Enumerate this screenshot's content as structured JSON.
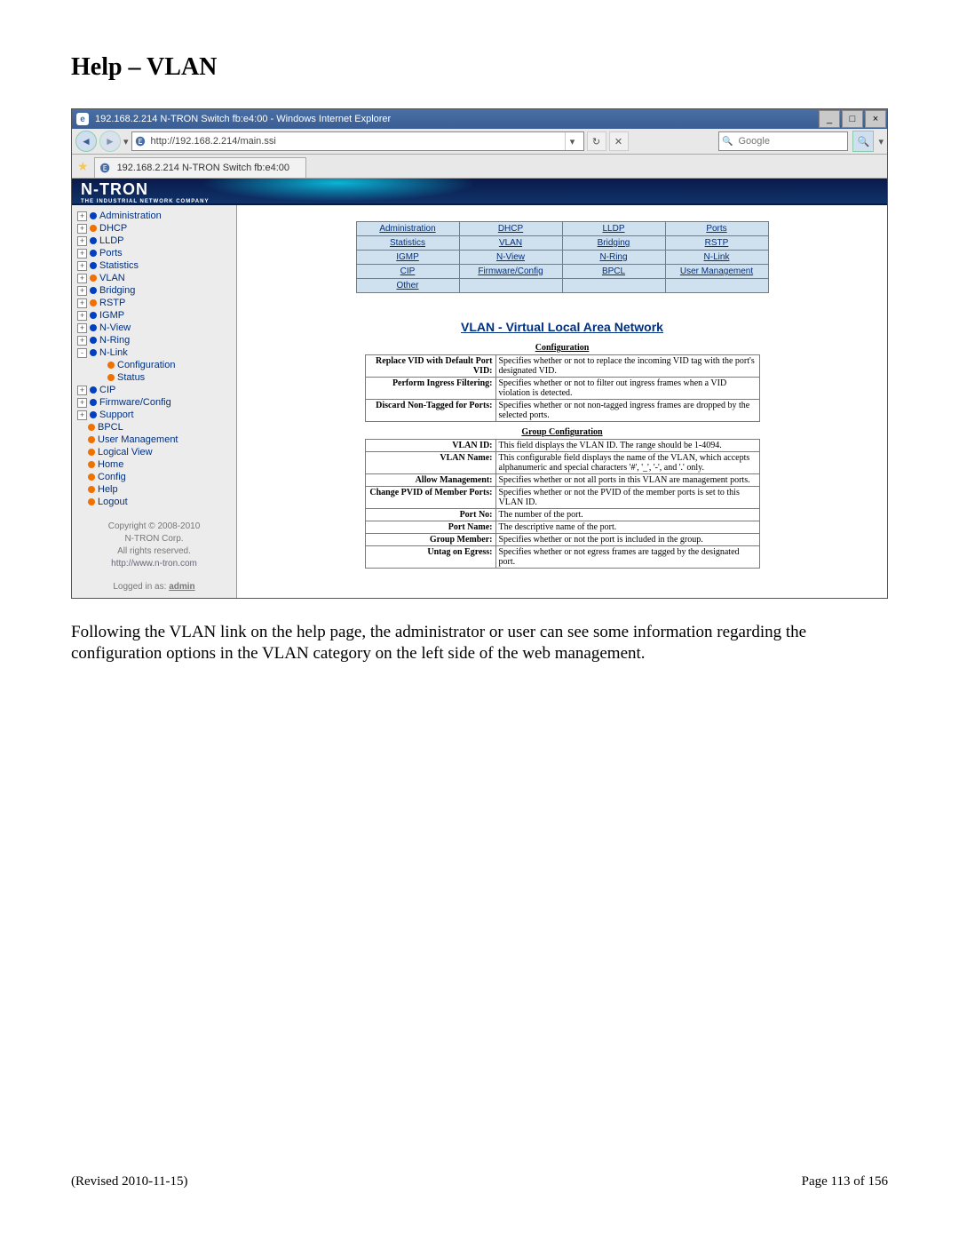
{
  "doc": {
    "heading": "Help – VLAN",
    "description": "Following the VLAN link on the help page, the administrator or user can see some information regarding the configuration options in the VLAN category on the left side of the web management.",
    "revised": "(Revised 2010-11-15)",
    "page": "Page 113 of 156"
  },
  "browser": {
    "title": "192.168.2.214 N-TRON Switch fb:e4:00 - Windows Internet Explorer",
    "url": "http://192.168.2.214/main.ssi",
    "search_placeholder": "Google",
    "tab": "192.168.2.214 N-TRON Switch fb:e4:00"
  },
  "logo": {
    "brand": "N-TRON",
    "tag": "THE INDUSTRIAL NETWORK COMPANY"
  },
  "tree": [
    {
      "exp": "+",
      "dot": "blue",
      "label": "Administration"
    },
    {
      "exp": "+",
      "dot": "orange",
      "label": "DHCP"
    },
    {
      "exp": "+",
      "dot": "blue",
      "label": "LLDP"
    },
    {
      "exp": "+",
      "dot": "blue",
      "label": "Ports"
    },
    {
      "exp": "+",
      "dot": "blue",
      "label": "Statistics"
    },
    {
      "exp": "+",
      "dot": "orange",
      "label": "VLAN"
    },
    {
      "exp": "+",
      "dot": "blue",
      "label": "Bridging"
    },
    {
      "exp": "+",
      "dot": "orange",
      "label": "RSTP"
    },
    {
      "exp": "+",
      "dot": "blue",
      "label": "IGMP"
    },
    {
      "exp": "+",
      "dot": "blue",
      "label": "N-View"
    },
    {
      "exp": "+",
      "dot": "blue",
      "label": "N-Ring"
    },
    {
      "exp": "-",
      "dot": "blue",
      "label": "N-Link"
    },
    {
      "exp": "",
      "dot": "orange",
      "label": "Configuration",
      "child": true
    },
    {
      "exp": "",
      "dot": "orange",
      "label": "Status",
      "child": true
    },
    {
      "exp": "+",
      "dot": "blue",
      "label": "CIP"
    },
    {
      "exp": "+",
      "dot": "blue",
      "label": "Firmware/Config"
    },
    {
      "exp": "+",
      "dot": "blue",
      "label": "Support"
    },
    {
      "exp": "",
      "dot": "orange",
      "label": "BPCL"
    },
    {
      "exp": "",
      "dot": "orange",
      "label": "User Management"
    },
    {
      "exp": "",
      "dot": "orange",
      "label": "Logical View"
    },
    {
      "exp": "",
      "dot": "orange",
      "label": "Home"
    },
    {
      "exp": "",
      "dot": "orange",
      "label": "Config"
    },
    {
      "exp": "",
      "dot": "orange",
      "label": "Help"
    },
    {
      "exp": "",
      "dot": "orange",
      "label": "Logout"
    }
  ],
  "sidefoot": {
    "copy": "Copyright © 2008-2010",
    "corp": "N-TRON Corp.",
    "rights": "All rights reserved.",
    "url": "http://www.n-tron.com",
    "logged_label": "Logged in as:",
    "logged_user": "admin"
  },
  "grid": [
    [
      "Administration",
      "DHCP",
      "LLDP",
      "Ports"
    ],
    [
      "Statistics",
      "VLAN",
      "Bridging",
      "RSTP"
    ],
    [
      "IGMP",
      "N-View",
      "N-Ring",
      "N-Link"
    ],
    [
      "CIP",
      "Firmware/Config",
      "BPCL",
      "User Management"
    ],
    [
      "Other",
      "",
      "",
      ""
    ]
  ],
  "section": {
    "title": "VLAN - Virtual Local Area Network",
    "sub1": "Configuration",
    "sub2": "Group Configuration"
  },
  "cfg": [
    {
      "k": "Replace VID with Default Port VID:",
      "v": "Specifies whether or not to replace the incoming VID tag with the port's designated VID."
    },
    {
      "k": "Perform Ingress Filtering:",
      "v": "Specifies whether or not to filter out ingress frames when a VID violation is detected."
    },
    {
      "k": "Discard Non-Tagged for Ports:",
      "v": "Specifies whether or not non-tagged ingress frames are dropped by the selected ports."
    }
  ],
  "grp": [
    {
      "k": "VLAN ID:",
      "v": "This field displays the VLAN ID. The range should be 1-4094."
    },
    {
      "k": "VLAN Name:",
      "v": "This configurable field displays the name of the VLAN, which accepts alphanumeric and special characters '#', '_', '-', and '.' only."
    },
    {
      "k": "Allow Management:",
      "v": "Specifies whether or not all ports in this VLAN are management ports."
    },
    {
      "k": "Change PVID of Member Ports:",
      "v": "Specifies whether or not the PVID of the member ports is set to this VLAN ID."
    },
    {
      "k": "Port No:",
      "v": "The number of the port."
    },
    {
      "k": "Port Name:",
      "v": "The descriptive name of the port."
    },
    {
      "k": "Group Member:",
      "v": "Specifies whether or not the port is included in the group."
    },
    {
      "k": "Untag on Egress:",
      "v": "Specifies whether or not egress frames are tagged by the designated port."
    }
  ]
}
